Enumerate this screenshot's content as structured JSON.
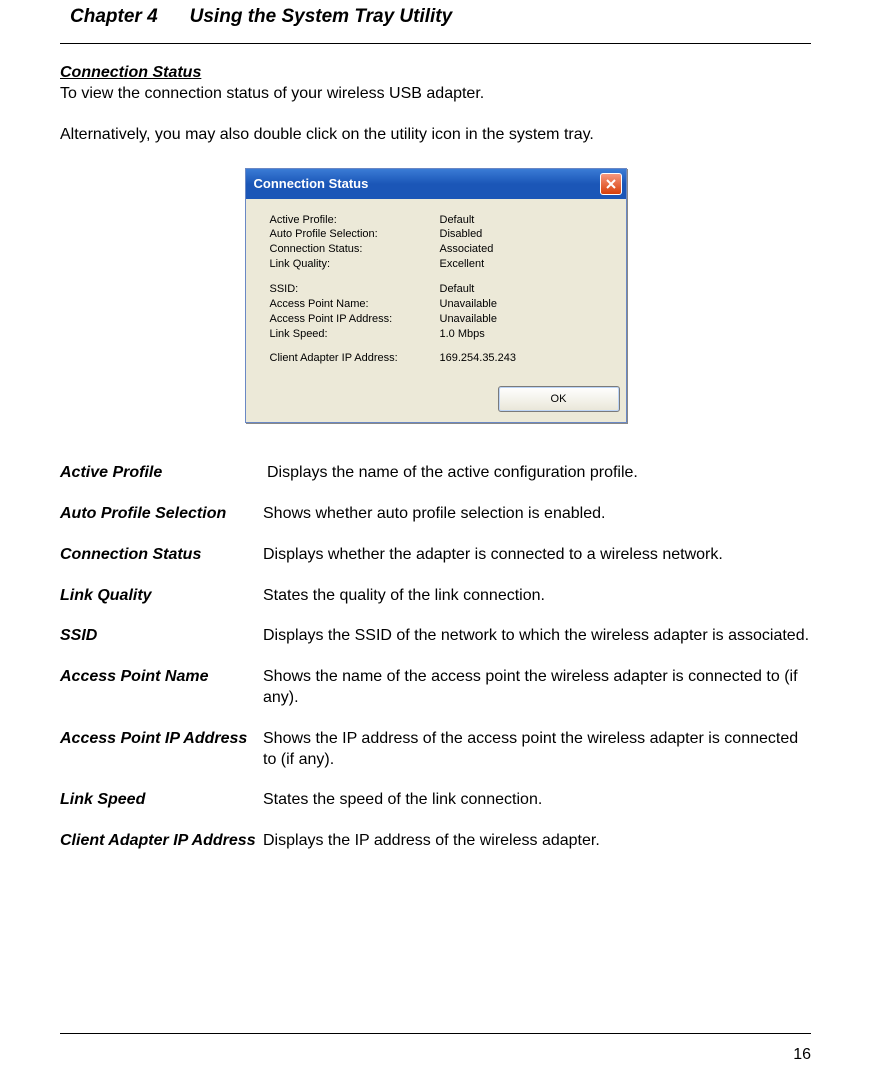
{
  "chapter": {
    "prefix": "Chapter 4",
    "title": "Using the System Tray Utility"
  },
  "section_heading": "Connection Status",
  "intro1": "To view the connection status of your wireless USB adapter.",
  "intro2": "Alternatively, you may also double click on the utility icon in the system tray.",
  "dialog": {
    "title": "Connection Status",
    "rows": [
      {
        "label": "Active Profile:",
        "value": "Default"
      },
      {
        "label": "Auto Profile Selection:",
        "value": "Disabled"
      },
      {
        "label": "Connection Status:",
        "value": "Associated"
      },
      {
        "label": "Link Quality:",
        "value": "Excellent"
      }
    ],
    "rows2": [
      {
        "label": "SSID:",
        "value": "Default"
      },
      {
        "label": "Access Point Name:",
        "value": "Unavailable"
      },
      {
        "label": "Access Point IP Address:",
        "value": "Unavailable"
      },
      {
        "label": "Link Speed:",
        "value": "1.0 Mbps"
      }
    ],
    "rows3": [
      {
        "label": "Client Adapter IP Address:",
        "value": "169.254.35.243"
      }
    ],
    "ok": "OK"
  },
  "definitions": [
    {
      "term": "Active Profile",
      "desc": "Displays the name of the active configuration profile."
    },
    {
      "term": "Auto Profile Selection",
      "desc": "Shows whether auto profile selection is enabled."
    },
    {
      "term": "Connection Status",
      "desc": "Displays whether the adapter is connected to a wireless network."
    },
    {
      "term": "Link Quality",
      "desc": "States the quality of the link connection."
    },
    {
      "term": "SSID",
      "desc": "Displays the SSID of the network to which the wireless adapter is associated."
    },
    {
      "term": "Access Point Name",
      "desc": "Shows the name of the access point the wireless adapter is connected to (if any)."
    },
    {
      "term": "Access Point IP Address",
      "desc": "Shows the IP address of the access point the wireless adapter is connected to (if any)."
    },
    {
      "term": "Link Speed",
      "desc": "States the speed of the link connection."
    },
    {
      "term": "Client Adapter IP Address",
      "desc": "Displays the IP address of the wireless adapter."
    }
  ],
  "page_number": "16"
}
